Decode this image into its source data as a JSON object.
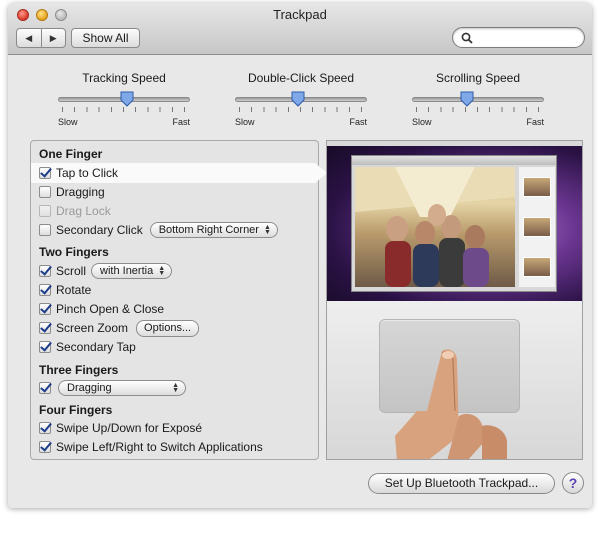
{
  "window": {
    "title": "Trackpad"
  },
  "toolbar": {
    "back_icon": "chevron-left-icon",
    "forward_icon": "chevron-right-icon",
    "show_all_label": "Show All",
    "search_value": "",
    "search_placeholder": ""
  },
  "sliders": [
    {
      "label": "Tracking Speed",
      "min_label": "Slow",
      "max_label": "Fast",
      "value": 0.52
    },
    {
      "label": "Double-Click Speed",
      "min_label": "Slow",
      "max_label": "Fast",
      "value": 0.48
    },
    {
      "label": "Scrolling Speed",
      "min_label": "Slow",
      "max_label": "Fast",
      "value": 0.42
    }
  ],
  "gestures": {
    "one_finger": {
      "heading": "One Finger",
      "tap_to_click": {
        "label": "Tap to Click",
        "checked": true
      },
      "dragging": {
        "label": "Dragging",
        "checked": false
      },
      "drag_lock": {
        "label": "Drag Lock",
        "checked": false,
        "disabled": true
      },
      "secondary_click": {
        "label": "Secondary Click",
        "checked": false,
        "option": "Bottom Right Corner"
      }
    },
    "two_fingers": {
      "heading": "Two Fingers",
      "scroll": {
        "label": "Scroll",
        "checked": true,
        "option": "with Inertia"
      },
      "rotate": {
        "label": "Rotate",
        "checked": true
      },
      "pinch": {
        "label": "Pinch Open & Close",
        "checked": true
      },
      "screen_zoom": {
        "label": "Screen Zoom",
        "checked": true,
        "button": "Options..."
      },
      "secondary_tap": {
        "label": "Secondary Tap",
        "checked": true
      }
    },
    "three_fingers": {
      "heading": "Three Fingers",
      "dragging": {
        "checked": true,
        "option": "Dragging"
      }
    },
    "four_fingers": {
      "heading": "Four Fingers",
      "expose": {
        "label": "Swipe Up/Down for Exposé",
        "checked": true
      },
      "switch_apps": {
        "label": "Swipe Left/Right to Switch Applications",
        "checked": true
      }
    }
  },
  "footer": {
    "bluetooth_button": "Set Up Bluetooth Trackpad...",
    "help_label": "?"
  },
  "colors": {
    "accent": "#1c3d8a",
    "help": "#5a3fb0"
  }
}
